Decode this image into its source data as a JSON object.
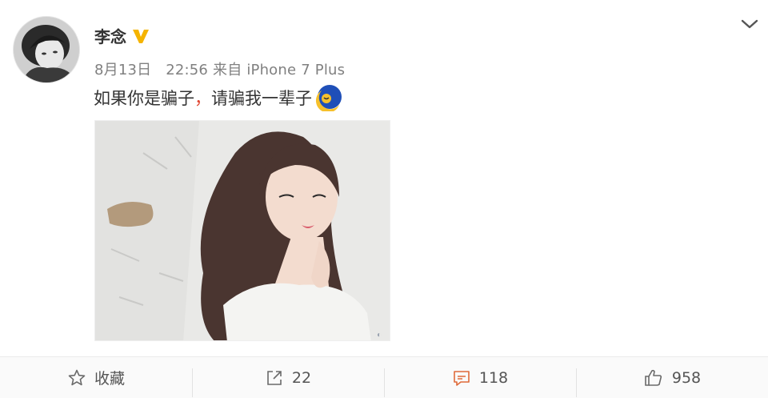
{
  "post": {
    "username": "李念",
    "date": "8月13日",
    "time": "22:56",
    "source": "来自 iPhone 7 Plus",
    "text_before_comma": "如果你是骗子",
    "comma": "，",
    "text_after_comma": "请骗我一辈子",
    "emoji_name": "moon-face-emoji",
    "image_description_icon": "photo"
  },
  "actions": {
    "favorite_label": "收藏",
    "repost_count": "22",
    "comment_count": "118",
    "like_count": "958"
  },
  "colors": {
    "accent_comma": "#e0442f",
    "verified_badge": "#f5b400",
    "text_primary": "#333333",
    "text_meta": "#808080"
  }
}
